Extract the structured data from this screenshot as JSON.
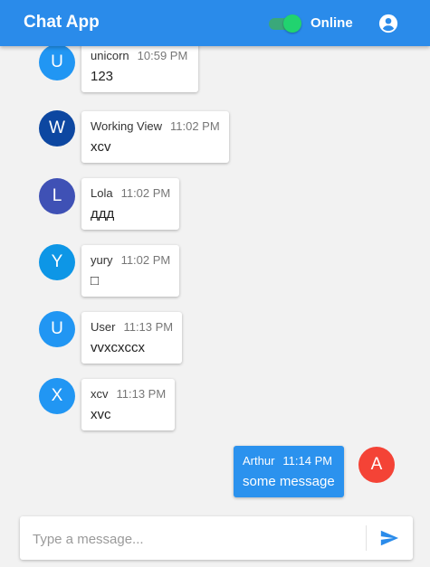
{
  "app": {
    "title": "Chat App"
  },
  "header": {
    "status_label": "Online",
    "online": true,
    "account_icon": "account-circle-icon"
  },
  "colors": {
    "appbar": "#2a8bea",
    "own_bubble": "#2b92ee",
    "toggle_on": "#21d36f"
  },
  "messages": [
    {
      "initial": "U",
      "author": "unicorn",
      "time": "10:59 PM",
      "text": "123",
      "avatar_color": "#2196f3"
    },
    {
      "initial": "W",
      "author": "Working View",
      "time": "11:02 PM",
      "text": "xcv",
      "avatar_color": "#0d47a1"
    },
    {
      "initial": "L",
      "author": "Lola",
      "time": "11:02 PM",
      "text": "ддд",
      "avatar_color": "#3f51b5"
    },
    {
      "initial": "Y",
      "author": "yury",
      "time": "11:02 PM",
      "text": "□",
      "avatar_color": "#0d96e6"
    },
    {
      "initial": "U",
      "author": "User",
      "time": "11:13 PM",
      "text": "vvxcxccx",
      "avatar_color": "#2196f3"
    },
    {
      "initial": "X",
      "author": "xcv",
      "time": "11:13 PM",
      "text": "xvc",
      "avatar_color": "#2196f3"
    },
    {
      "initial": "A",
      "author": "Arthur",
      "time": "11:14 PM",
      "text": "some message",
      "avatar_color": "#f44336",
      "own": true
    }
  ],
  "composer": {
    "placeholder": "Type a message...",
    "value": "",
    "send_icon": "send-icon"
  }
}
